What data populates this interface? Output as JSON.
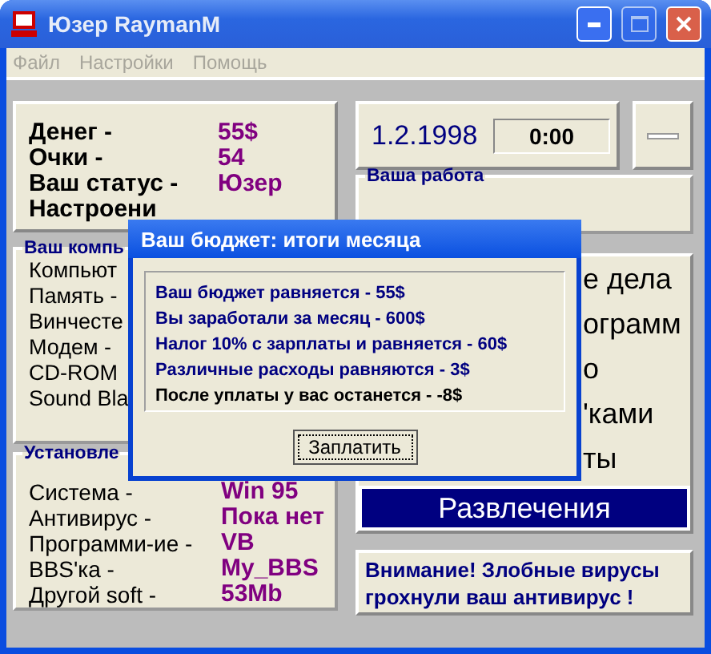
{
  "window": {
    "title": "Юзер RaymanM"
  },
  "menu": [
    {
      "label": "Файл",
      "disabled": true
    },
    {
      "label": "Настройки",
      "disabled": true
    },
    {
      "label": "Помощь",
      "disabled": true
    }
  ],
  "stats": [
    {
      "label": "Денег -",
      "value": "55$"
    },
    {
      "label": "Очки -",
      "value": "54"
    },
    {
      "label": "Ваш статус -",
      "value": "Юзер"
    },
    {
      "label": "Настроени"
    }
  ],
  "date": "1.2.1998",
  "time": "0:00",
  "work": {
    "title": "Ваша работа"
  },
  "computer": {
    "title": "Ваш компь",
    "items": [
      "Компьют",
      "Память -",
      "Винчесте",
      "Модем -",
      "CD-ROM",
      "Sound Bla"
    ]
  },
  "installed": {
    "title": "Установле",
    "items": [
      {
        "label": "Система -",
        "value": "Win 95"
      },
      {
        "label": "Антивирус -",
        "value": "Пока нет"
      },
      {
        "label": "Программи-ие -",
        "value": "VB"
      },
      {
        "label": "BBS'ка -",
        "value": "My_BBS"
      },
      {
        "label": "Другой soft -",
        "value": "53Mb"
      }
    ]
  },
  "actions": [
    {
      "label": "е дела",
      "selected": false
    },
    {
      "label": "ограмм",
      "selected": false
    },
    {
      "label": "о",
      "selected": false
    },
    {
      "label": "'ками",
      "selected": false
    },
    {
      "label": "ты",
      "selected": false
    },
    {
      "label": "Развлечения",
      "selected": true
    }
  ],
  "warning": "Внимание! Злобные вирусы грохнули ваш антивирус !",
  "dialog": {
    "title": "Ваш бюджет: итоги месяца",
    "lines": [
      {
        "text": "Ваш бюджет равняется - 55$",
        "kind": "item"
      },
      {
        "text": "Вы заработали за месяц - 600$",
        "kind": "item"
      },
      {
        "text": "Налог 10% с зарплаты и равняется - 60$",
        "kind": "item"
      },
      {
        "text": "Различные расходы равняются - 3$",
        "kind": "item"
      },
      {
        "text": "После уплаты у вас останется - -8$",
        "kind": "result"
      }
    ],
    "button": "Заплатить"
  }
}
